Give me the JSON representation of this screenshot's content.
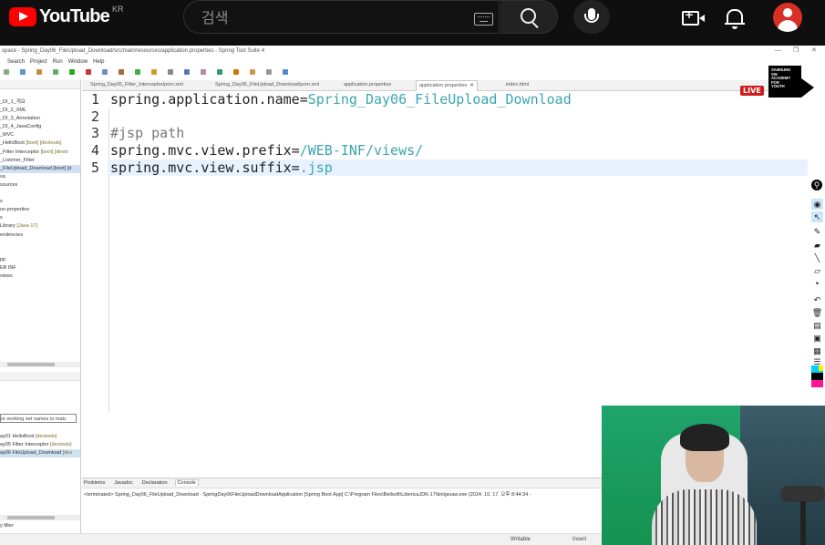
{
  "youtube": {
    "logo_text": "YouTube",
    "region": "KR",
    "search_placeholder": "검색",
    "icons": [
      "youtube-logo",
      "keyboard-icon",
      "search-icon",
      "mic-icon",
      "create-video-icon",
      "notifications-icon",
      "account-avatar"
    ]
  },
  "ide": {
    "window_title": "space - Spring_Day06_FileUpload_Download/src/main/resources/application.properties - Spring Tool Suite 4",
    "menu": [
      "Search",
      "Project",
      "Run",
      "Window",
      "Help"
    ],
    "package_explorer": [
      {
        "label": "_DI_1_개요",
        "decor": ""
      },
      {
        "label": "_DI_2_XML",
        "decor": ""
      },
      {
        "label": "_DI_3_Annotation",
        "decor": ""
      },
      {
        "label": "_DI_4_JavaConfig",
        "decor": ""
      },
      {
        "label": "_MVC",
        "decor": ""
      },
      {
        "label": "_HelloBoot",
        "decor": "[boot] [devtools]"
      },
      {
        "label": "_Filter Interceptor",
        "decor": "[boot] [devto"
      },
      {
        "label": "_Listener_Filter",
        "decor": ""
      },
      {
        "label": "_FileUpload_Download [boot] [d",
        "decor": "",
        "selected": true
      },
      {
        "label": "va",
        "decor": ""
      },
      {
        "label": "sources",
        "decor": ""
      },
      {
        "label": "",
        "decor": ""
      },
      {
        "label": "s",
        "decor": ""
      },
      {
        "label": "on.properties",
        "decor": ""
      },
      {
        "label": "s",
        "decor": ""
      },
      {
        "label": "Library",
        "decor": "[Java-17]"
      },
      {
        "label": "endencies",
        "decor": ""
      },
      {
        "label": "",
        "decor": ""
      },
      {
        "label": "",
        "decor": ""
      },
      {
        "label": "pp",
        "decor": ""
      },
      {
        "label": "EB INF",
        "decor": ""
      },
      {
        "label": "views",
        "decor": ""
      }
    ],
    "working_set_filter": "or working set names to matc",
    "boot_dashboard": [
      {
        "label": "ay01 HelloBoot",
        "decor": "[devtools]"
      },
      {
        "label": "ay05 Filter Interceptor",
        "decor": "[devtools]"
      },
      {
        "label": "ay06 FileUpload_Download",
        "decor": "[dev",
        "selected": true
      }
    ],
    "left_footer": "y filter",
    "editor_tabs": [
      {
        "label": "Spring_Day05_Filter_Interceptor/pom.xml",
        "active": false
      },
      {
        "label": "Spring_Day06_FileUpload_Download/pom.xml",
        "active": false
      },
      {
        "label": "application.properties",
        "active": false
      },
      {
        "label": "application.properties",
        "active": true
      },
      {
        "label": "index.html",
        "active": false
      }
    ],
    "code_lines": [
      {
        "num": "1",
        "key": "spring.application.name=",
        "value": "Spring_Day06_FileUpload_Download",
        "comment": ""
      },
      {
        "num": "2",
        "key": "",
        "value": "",
        "comment": ""
      },
      {
        "num": "3",
        "key": "",
        "value": "",
        "comment": "#jsp path"
      },
      {
        "num": "4",
        "key": "spring.mvc.view.prefix=",
        "value": "/WEB-INF/views/",
        "comment": ""
      },
      {
        "num": "5",
        "key": "spring.mvc.view.suffix=",
        "value": ".jsp",
        "comment": ""
      }
    ],
    "console_tabs": [
      "Problems",
      "Javadoc",
      "Declaration",
      "Console"
    ],
    "console_line": "<terminated> Spring_Day06_FileUpload_Download - SpringDay06FileUploadDownloadApplication [Spring Boot App] C:\\Program Files\\Bellsoft\\LibericaJDK-17\\bin\\javaw.exe (2024. 10. 17. 오후 8:44:34 -",
    "status": {
      "writable": "Writable",
      "insert": "Insert"
    }
  },
  "overlay": {
    "live": "LIVE",
    "logo_lines": [
      "SAMSUNG",
      "SW",
      "ACADEMY",
      "FOR",
      "YOUTH"
    ]
  },
  "colors": {
    "yt_red": "#ff0000",
    "property_value": "#3aa5b0",
    "current_line": "#e8f2fe",
    "live_badge": "#cc1c1c"
  }
}
